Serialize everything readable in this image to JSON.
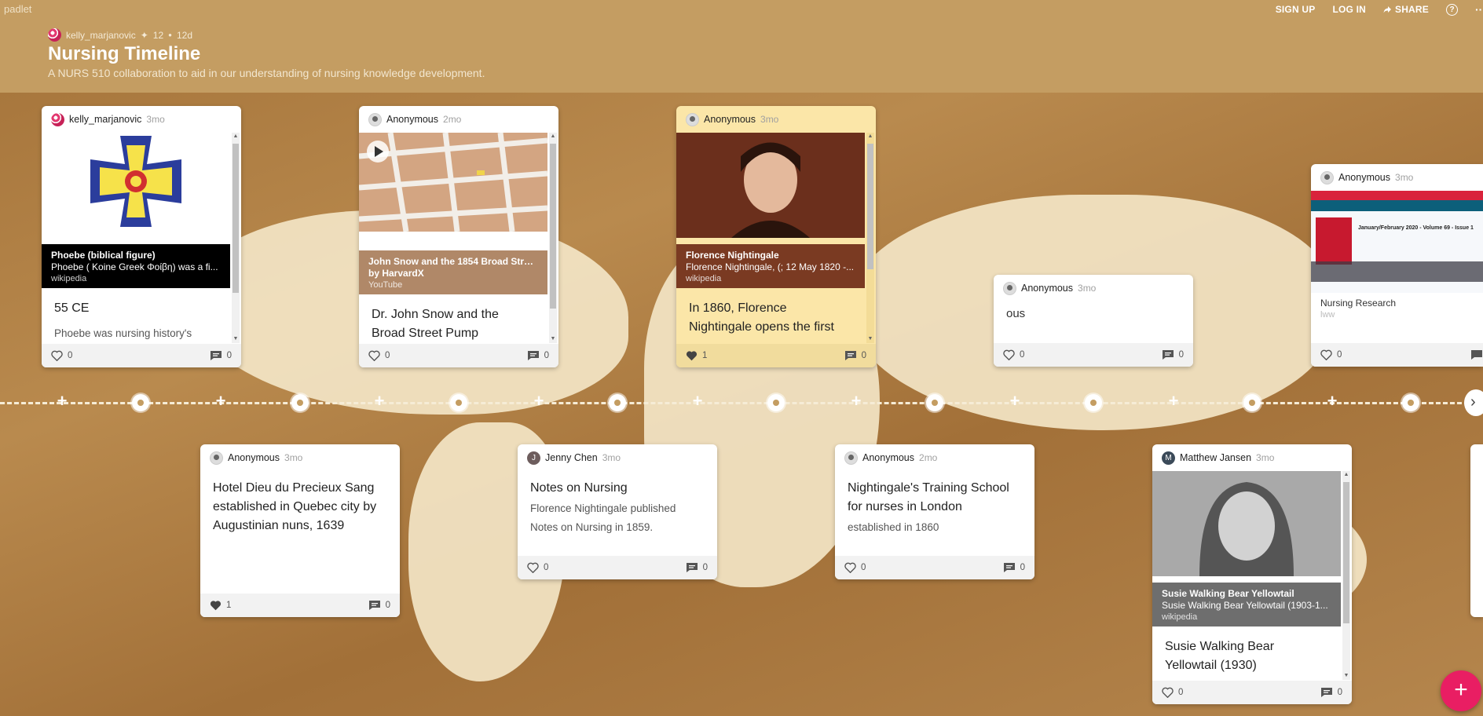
{
  "brand": "padlet",
  "top_actions": {
    "signup": "SIGN UP",
    "login": "LOG IN",
    "share": "SHARE"
  },
  "meta": {
    "author": "kelly_marjanovic",
    "count": "12",
    "age": "12d"
  },
  "title": "Nursing Timeline",
  "subtitle": "A NURS 510 collaboration to aid in our understanding of nursing knowledge development.",
  "colors": {
    "header": "#c49d62",
    "accent": "#e91e63",
    "yellow_card": "#fbe6a8"
  },
  "cards": [
    {
      "author": "kelly_marjanovic",
      "time": "3mo",
      "avatar": "pink",
      "attachment": {
        "title": "Phoebe (biblical figure)",
        "desc": "Phoebe ( Koine Greek Φοίβη) was a fi...",
        "source": "wikipedia"
      },
      "post_title": "55 CE",
      "post_text": "Phoebe was nursing history's",
      "likes": "0",
      "comments": "0"
    },
    {
      "author": "Anonymous",
      "time": "2mo",
      "attachment": {
        "title": "John Snow and the 1854 Broad Stree...",
        "desc": "by HarvardX",
        "source": "YouTube"
      },
      "post_title": "Dr. John Snow and the Broad Street Pump",
      "likes": "0",
      "comments": "0"
    },
    {
      "author": "Anonymous",
      "time": "3mo",
      "attachment": {
        "title": "Florence Nightingale",
        "desc": "Florence Nightingale, (; 12 May 1820 -...",
        "source": "wikipedia"
      },
      "post_title": "In 1860, Florence Nightingale opens the first",
      "likes": "1",
      "comments": "0"
    },
    {
      "author": "Anonymous",
      "time": "3mo",
      "post_text": "ous",
      "likes": "0",
      "comments": "0"
    },
    {
      "author": "Anonymous",
      "time": "3mo",
      "attachment": {
        "title": "Nursing Research",
        "source": "lww"
      },
      "likes": "0"
    },
    {
      "author": "Anonymous",
      "time": "3mo",
      "post_title": "Hotel Dieu du Precieux Sang established in Quebec city by Augustinian nuns, 1639",
      "likes": "1",
      "comments": "0"
    },
    {
      "author": "Jenny Chen",
      "time": "3mo",
      "initial": "J",
      "post_title": "Notes on Nursing",
      "post_text": "Florence Nightingale published Notes on Nursing in 1859.",
      "likes": "0",
      "comments": "0"
    },
    {
      "author": "Anonymous",
      "time": "2mo",
      "post_title": "Nightingale's Training School for nurses in London",
      "post_text": "established in 1860",
      "likes": "0",
      "comments": "0"
    },
    {
      "author": "Matthew Jansen",
      "time": "3mo",
      "initial": "M",
      "attachment": {
        "title": "Susie Walking Bear Yellowtail",
        "desc": "Susie Walking Bear Yellowtail (1903-1...",
        "source": "wikipedia"
      },
      "post_title": "Susie Walking Bear Yellowtail (1930)",
      "likes": "0",
      "comments": "0"
    }
  ],
  "journal_thumb": {
    "header": "January/February 2020 - Volume 69 - Issue 1",
    "name": "Nursing Research"
  }
}
